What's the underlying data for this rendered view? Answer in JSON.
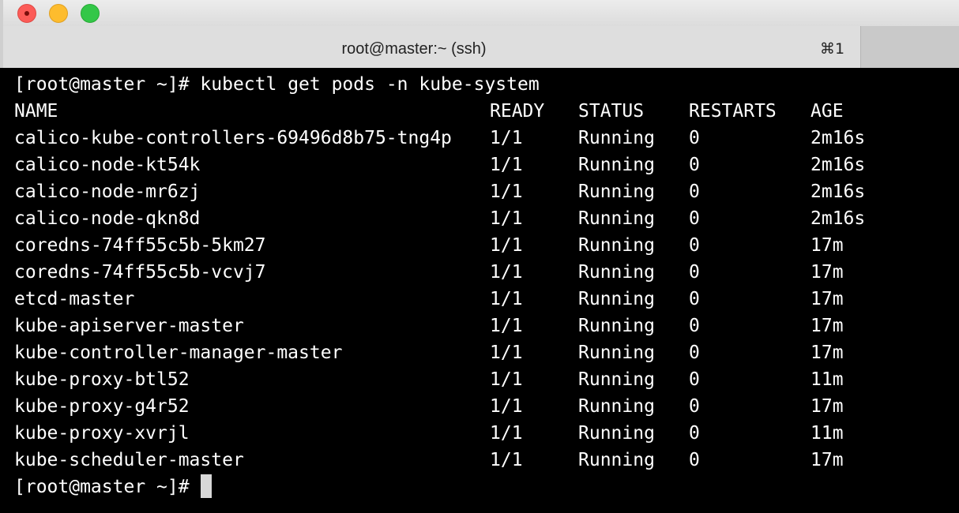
{
  "window": {
    "tab_title": "root@master:~ (ssh)",
    "tab_shortcut": "⌘1"
  },
  "terminal": {
    "prompt": "[root@master ~]#",
    "command": "kubectl get pods -n kube-system",
    "headers": {
      "name": "NAME",
      "ready": "READY",
      "status": "STATUS",
      "restarts": "RESTARTS",
      "age": "AGE"
    },
    "rows": [
      {
        "name": "calico-kube-controllers-69496d8b75-tng4p",
        "ready": "1/1",
        "status": "Running",
        "restarts": "0",
        "age": "2m16s"
      },
      {
        "name": "calico-node-kt54k",
        "ready": "1/1",
        "status": "Running",
        "restarts": "0",
        "age": "2m16s"
      },
      {
        "name": "calico-node-mr6zj",
        "ready": "1/1",
        "status": "Running",
        "restarts": "0",
        "age": "2m16s"
      },
      {
        "name": "calico-node-qkn8d",
        "ready": "1/1",
        "status": "Running",
        "restarts": "0",
        "age": "2m16s"
      },
      {
        "name": "coredns-74ff55c5b-5km27",
        "ready": "1/1",
        "status": "Running",
        "restarts": "0",
        "age": "17m"
      },
      {
        "name": "coredns-74ff55c5b-vcvj7",
        "ready": "1/1",
        "status": "Running",
        "restarts": "0",
        "age": "17m"
      },
      {
        "name": "etcd-master",
        "ready": "1/1",
        "status": "Running",
        "restarts": "0",
        "age": "17m"
      },
      {
        "name": "kube-apiserver-master",
        "ready": "1/1",
        "status": "Running",
        "restarts": "0",
        "age": "17m"
      },
      {
        "name": "kube-controller-manager-master",
        "ready": "1/1",
        "status": "Running",
        "restarts": "0",
        "age": "17m"
      },
      {
        "name": "kube-proxy-btl52",
        "ready": "1/1",
        "status": "Running",
        "restarts": "0",
        "age": "11m"
      },
      {
        "name": "kube-proxy-g4r52",
        "ready": "1/1",
        "status": "Running",
        "restarts": "0",
        "age": "17m"
      },
      {
        "name": "kube-proxy-xvrjl",
        "ready": "1/1",
        "status": "Running",
        "restarts": "0",
        "age": "11m"
      },
      {
        "name": "kube-scheduler-master",
        "ready": "1/1",
        "status": "Running",
        "restarts": "0",
        "age": "17m"
      }
    ],
    "final_prompt": "[root@master ~]#"
  }
}
